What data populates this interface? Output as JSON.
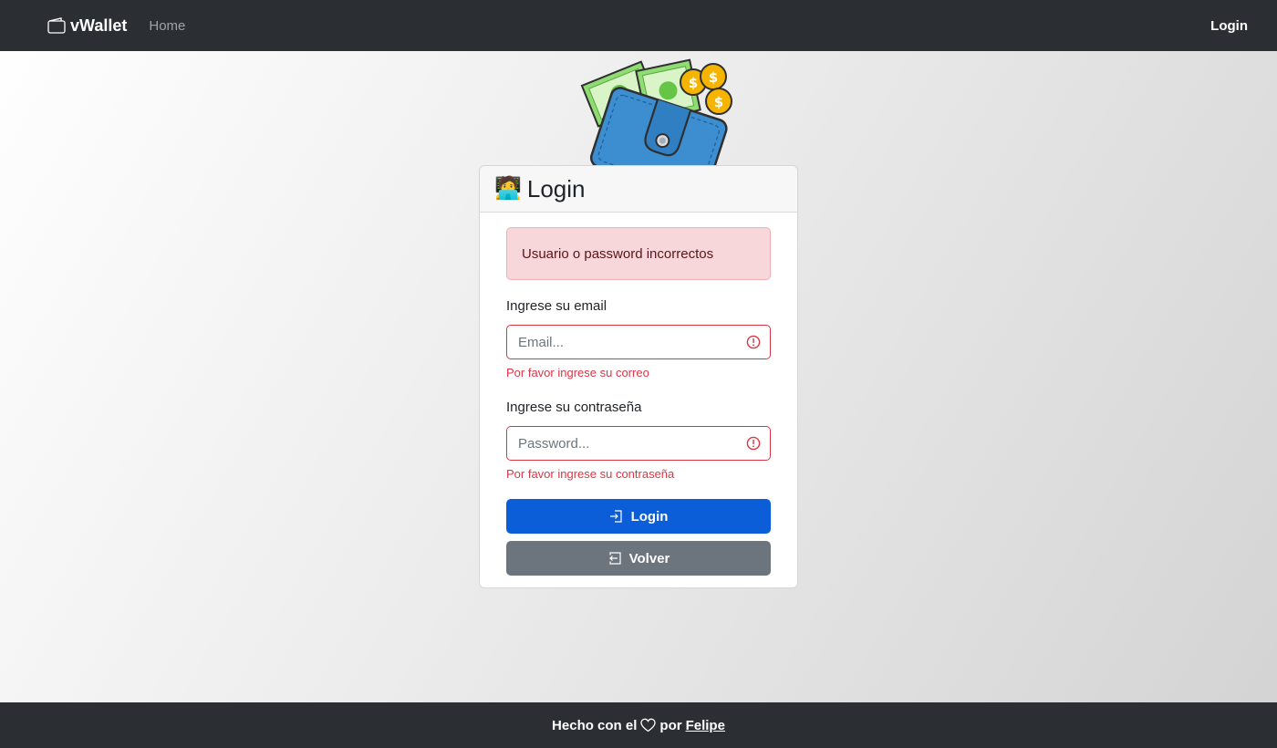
{
  "navbar": {
    "brand_icon": "wallet-icon",
    "brand": "vWallet",
    "home": "Home",
    "login": "Login"
  },
  "illustration": {
    "name": "wallet-with-money-illustration"
  },
  "card": {
    "emoji": "🧑‍💻",
    "title": "Login",
    "alert": "Usuario o password incorrectos",
    "email": {
      "label": "Ingrese su email",
      "placeholder": "Email...",
      "value": "",
      "error": "Por favor ingrese su correo"
    },
    "password": {
      "label": "Ingrese su contraseña",
      "placeholder": "Password...",
      "value": "",
      "error": "Por favor ingrese su contraseña"
    },
    "login_button": "Login",
    "back_button": "Volver"
  },
  "footer": {
    "prefix": "Hecho con el",
    "icon": "heart-icon",
    "middle": "por",
    "author": "Felipe"
  },
  "colors": {
    "navbar_bg": "#2b2f33",
    "primary": "#0b5ed7",
    "secondary": "#6c757d",
    "danger": "#dc3545",
    "alert_bg": "#f8d7da"
  }
}
